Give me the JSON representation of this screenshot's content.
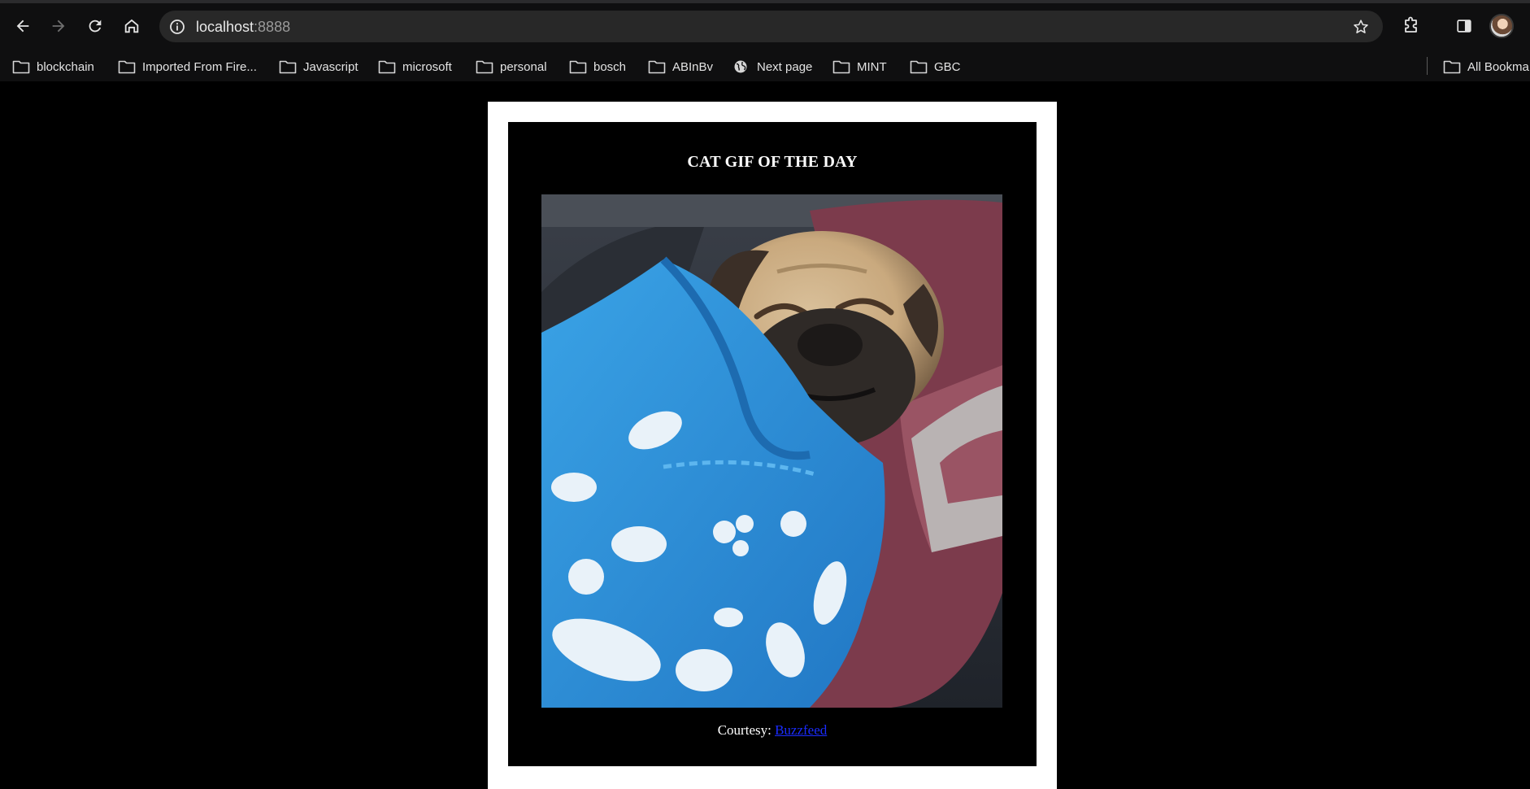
{
  "browser": {
    "url_host": "localhost",
    "url_port": ":8888",
    "bookmarks": [
      {
        "label": "blockchain",
        "icon": "folder-icon"
      },
      {
        "label": "Imported From Fire...",
        "icon": "folder-icon"
      },
      {
        "label": "Javascript",
        "icon": "folder-icon"
      },
      {
        "label": "microsoft",
        "icon": "folder-icon"
      },
      {
        "label": "personal",
        "icon": "folder-icon"
      },
      {
        "label": "bosch",
        "icon": "folder-icon"
      },
      {
        "label": "ABInBv",
        "icon": "folder-icon"
      },
      {
        "label": "Next page",
        "icon": "globe-icon"
      },
      {
        "label": "MINT",
        "icon": "folder-icon"
      },
      {
        "label": "GBC",
        "icon": "folder-icon"
      }
    ],
    "all_bookmarks_label": "All Bookma"
  },
  "page": {
    "title": "CAT GIF OF THE DAY",
    "courtesy_prefix": "Courtesy:",
    "courtesy_link": "Buzzfeed",
    "image_subject": "pug wrapped in blue bone-print blanket",
    "colors": {
      "page_background": "#000000",
      "frame": "#ffffff",
      "link": "#1a2cff"
    }
  }
}
